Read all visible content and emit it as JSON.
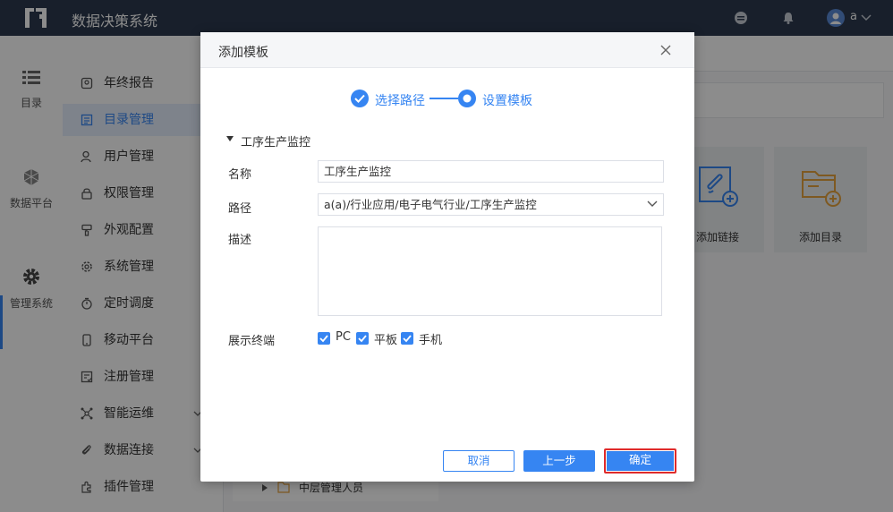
{
  "app": {
    "title": "数据决策系统",
    "user": "a"
  },
  "leftnav": [
    {
      "label": "目录",
      "icon": "list-icon"
    },
    {
      "label": "数据平台",
      "icon": "cubes-icon"
    },
    {
      "label": "管理系统",
      "icon": "gear-icon"
    }
  ],
  "secnav": [
    {
      "label": "年终报告",
      "icon": "report-icon"
    },
    {
      "label": "目录管理",
      "icon": "directory-icon",
      "active": true
    },
    {
      "label": "用户管理",
      "icon": "user-icon"
    },
    {
      "label": "权限管理",
      "icon": "lock-icon"
    },
    {
      "label": "外观配置",
      "icon": "brush-icon"
    },
    {
      "label": "系统管理",
      "icon": "settings-icon"
    },
    {
      "label": "定时调度",
      "icon": "timer-icon"
    },
    {
      "label": "移动平台",
      "icon": "mobile-icon"
    },
    {
      "label": "注册管理",
      "icon": "register-icon"
    },
    {
      "label": "智能运维",
      "icon": "ops-icon",
      "expandable": true
    },
    {
      "label": "数据连接",
      "icon": "link-icon",
      "expandable": true
    },
    {
      "label": "插件管理",
      "icon": "plugin-icon"
    }
  ],
  "background": {
    "cards": [
      {
        "label": "添加链接",
        "icon": "add-link-icon"
      },
      {
        "label": "添加目录",
        "icon": "add-folder-icon"
      }
    ],
    "tree_item": "中层管理人员"
  },
  "dialog": {
    "title": "添加模板",
    "steps": [
      {
        "label": "选择路径",
        "state": "done"
      },
      {
        "label": "设置模板",
        "state": "current"
      }
    ],
    "group_title": "工序生产监控",
    "name_label": "名称",
    "name_value": "工序生产监控",
    "path_label": "路径",
    "path_value": "a(a)/行业应用/电子电气行业/工序生产监控",
    "desc_label": "描述",
    "desc_value": "",
    "terminal_label": "展示终端",
    "terminals": [
      {
        "label": "PC",
        "checked": true
      },
      {
        "label": "平板",
        "checked": true
      },
      {
        "label": "手机",
        "checked": true
      }
    ],
    "buttons": {
      "cancel": "取消",
      "prev": "上一步",
      "ok": "确定"
    }
  },
  "colors": {
    "accent": "#3685f2",
    "topbar": "#2d3a4f",
    "highlight": "#e02b2b"
  }
}
